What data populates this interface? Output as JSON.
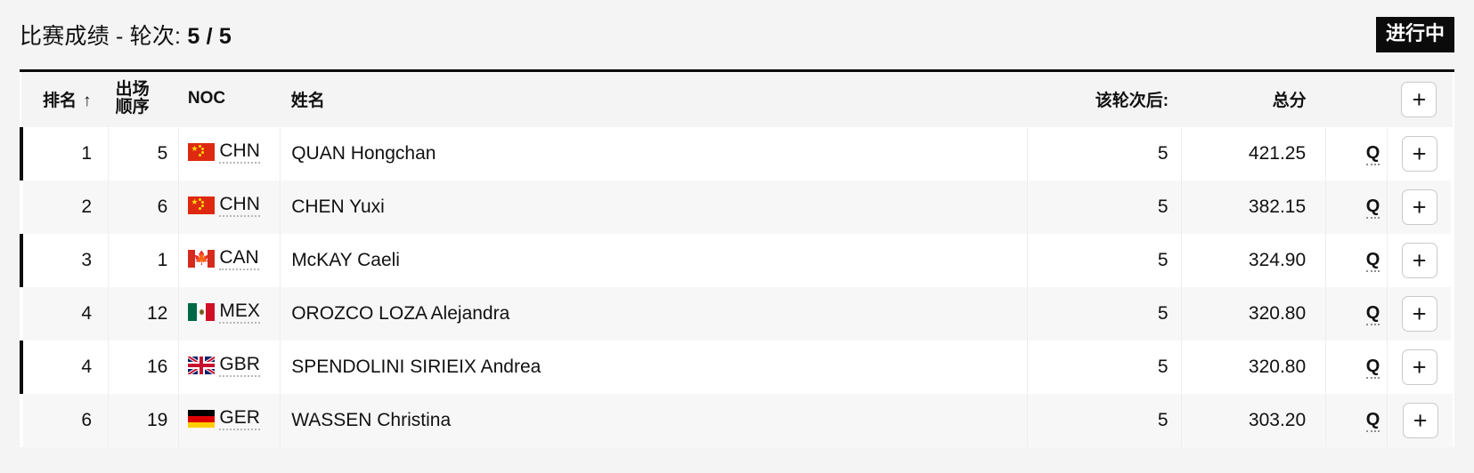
{
  "header": {
    "title_prefix": "比赛成绩 - 轮次: ",
    "round_current": "5",
    "round_separator": " / ",
    "round_total": "5",
    "status_badge": "进行中",
    "badge_bg": "#0b0b0b",
    "badge_fg": "#ffffff"
  },
  "table": {
    "columns": {
      "rank": "排名",
      "rank_sort_icon": "↑",
      "start_order": "出场\n顺序",
      "noc": "NOC",
      "name": "姓名",
      "after_round": "该轮次后:",
      "total": "总分",
      "qualified": "",
      "expand": "+"
    },
    "rows": [
      {
        "rank": "1",
        "start_order": "5",
        "noc": "CHN",
        "flag": "flag-chn",
        "name": "QUAN Hongchan",
        "after_round": "5",
        "total": "421.25",
        "qualified": "Q",
        "expand": "+",
        "highlight": true
      },
      {
        "rank": "2",
        "start_order": "6",
        "noc": "CHN",
        "flag": "flag-chn",
        "name": "CHEN Yuxi",
        "after_round": "5",
        "total": "382.15",
        "qualified": "Q",
        "expand": "+",
        "highlight": false
      },
      {
        "rank": "3",
        "start_order": "1",
        "noc": "CAN",
        "flag": "flag-can",
        "name": "McKAY Caeli",
        "after_round": "5",
        "total": "324.90",
        "qualified": "Q",
        "expand": "+",
        "highlight": true
      },
      {
        "rank": "4",
        "start_order": "12",
        "noc": "MEX",
        "flag": "flag-mex",
        "name": "OROZCO LOZA Alejandra",
        "after_round": "5",
        "total": "320.80",
        "qualified": "Q",
        "expand": "+",
        "highlight": false
      },
      {
        "rank": "4",
        "start_order": "16",
        "noc": "GBR",
        "flag": "flag-gbr",
        "name": "SPENDOLINI SIRIEIX Andrea",
        "after_round": "5",
        "total": "320.80",
        "qualified": "Q",
        "expand": "+",
        "highlight": true
      },
      {
        "rank": "6",
        "start_order": "19",
        "noc": "GER",
        "flag": "flag-ger",
        "name": "WASSEN Christina",
        "after_round": "5",
        "total": "303.20",
        "qualified": "Q",
        "expand": "+",
        "highlight": false
      }
    ]
  }
}
